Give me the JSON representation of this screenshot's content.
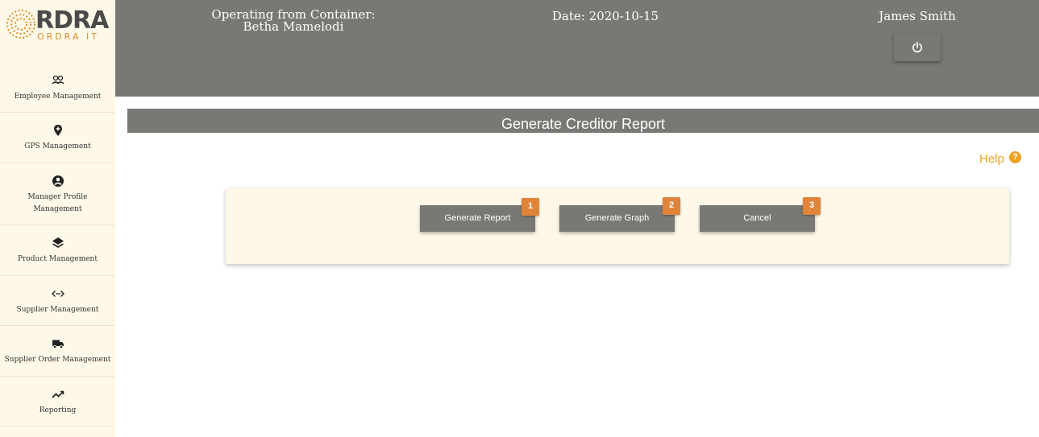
{
  "logo": {
    "brand": "RDRA",
    "sub": "ORDRA IT"
  },
  "sidebar": {
    "items": [
      {
        "label": "Employee Management",
        "icon": "people-icon"
      },
      {
        "label": "GPS Management",
        "icon": "map-pin-icon"
      },
      {
        "label": "Manager Profile Management",
        "icon": "account-circle-icon"
      },
      {
        "label": "Product Management",
        "icon": "layers-icon"
      },
      {
        "label": "Supplier Management",
        "icon": "code-arrows-icon"
      },
      {
        "label": "Supplier Order Management",
        "icon": "truck-icon"
      },
      {
        "label": "Reporting",
        "icon": "trending-icon"
      }
    ]
  },
  "header": {
    "container_label": "Operating from Container:",
    "container_name": "Betha Mamelodi",
    "date": "Date: 2020-10-15",
    "user": "James Smith"
  },
  "page": {
    "title": "Generate Creditor Report",
    "help_label": "Help",
    "help_badge": "?"
  },
  "actions": [
    {
      "label": "Generate Report",
      "badge": "1"
    },
    {
      "label": "Generate Graph",
      "badge": "2"
    },
    {
      "label": "Cancel",
      "badge": "3"
    }
  ],
  "colors": {
    "header_bg": "#7a7874",
    "sidebar_bg": "#fdf8e7",
    "accent": "#e0843a",
    "help": "#f0a020"
  }
}
